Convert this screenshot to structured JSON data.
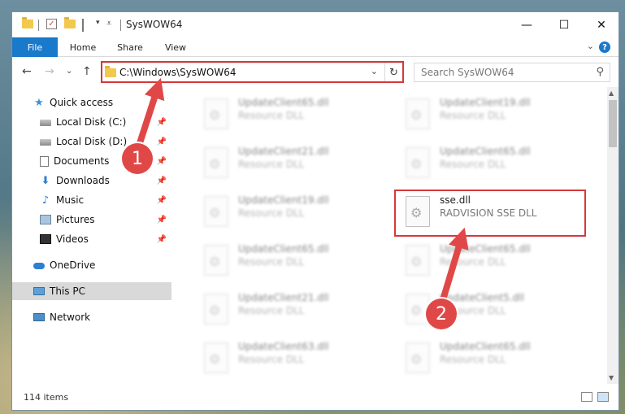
{
  "window": {
    "title": "SysWOW64",
    "controls": {
      "minimize": "—",
      "maximize": "☐",
      "close": "✕"
    }
  },
  "ribbon": {
    "tabs": [
      "File",
      "Home",
      "Share",
      "View"
    ],
    "help": "?",
    "toggle": "⌄"
  },
  "nav": {
    "back": "←",
    "forward": "→",
    "recent": "⌄",
    "up": "↑"
  },
  "address": {
    "path": "C:\\Windows\\SysWOW64",
    "dropdown": "⌄",
    "refresh": "↻"
  },
  "search": {
    "placeholder": "Search SysWOW64",
    "icon": "⚲"
  },
  "sidebar": {
    "items": [
      {
        "label": "Quick access",
        "icon": "star-icon",
        "pinned": false
      },
      {
        "label": "Local Disk (C:)",
        "icon": "disk-icon",
        "pinned": true
      },
      {
        "label": "Local Disk (D:)",
        "icon": "disk-icon",
        "pinned": true
      },
      {
        "label": "Documents",
        "icon": "document-icon",
        "pinned": true
      },
      {
        "label": "Downloads",
        "icon": "download-icon",
        "pinned": true
      },
      {
        "label": "Music",
        "icon": "music-icon",
        "pinned": true
      },
      {
        "label": "Pictures",
        "icon": "pictures-icon",
        "pinned": true
      },
      {
        "label": "Videos",
        "icon": "video-icon",
        "pinned": true
      },
      {
        "label": "OneDrive",
        "icon": "cloud-icon",
        "pinned": false
      },
      {
        "label": "This PC",
        "icon": "computer-icon",
        "pinned": false,
        "selected": true
      },
      {
        "label": "Network",
        "icon": "network-icon",
        "pinned": false
      }
    ]
  },
  "files": [
    {
      "name": "UpdateClient65.dll",
      "type": "Resource DLL"
    },
    {
      "name": "UpdateClient19.dll",
      "type": "Resource DLL"
    },
    {
      "name": "UpdateClient21.dll",
      "type": "Resource DLL"
    },
    {
      "name": "UpdateClient65.dll",
      "type": "Resource DLL"
    },
    {
      "name": "UpdateClient19.dll",
      "type": "Resource DLL"
    },
    {
      "name": "sse.dll",
      "type": "RADVISION SSE DLL",
      "highlighted": true
    },
    {
      "name": "UpdateClient65.dll",
      "type": "Resource DLL"
    },
    {
      "name": "UpdateClient65.dll",
      "type": "Resource DLL"
    },
    {
      "name": "UpdateClient21.dll",
      "type": "Resource DLL"
    },
    {
      "name": "UpdateClient5.dll",
      "type": "Resource DLL"
    },
    {
      "name": "UpdateClient63.dll",
      "type": "Resource DLL"
    },
    {
      "name": "UpdateClient65.dll",
      "type": "Resource DLL"
    }
  ],
  "status": {
    "count": "114 items"
  },
  "annotations": {
    "step1": "1",
    "step2": "2"
  },
  "colors": {
    "accent": "#1979ca",
    "highlight": "#d6383a",
    "badge": "#e04848"
  }
}
